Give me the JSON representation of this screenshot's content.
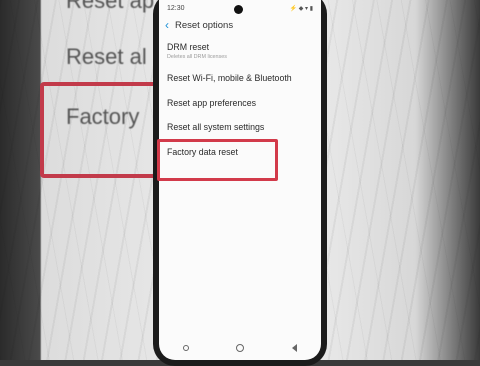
{
  "status_bar": {
    "time": "12:30",
    "icons": "⚡ ◆ ▾ ▮"
  },
  "header": {
    "title": "Reset options"
  },
  "settings_items": [
    {
      "label": "DRM reset",
      "subtitle": "Deletes all DRM licenses"
    },
    {
      "label": "Reset Wi-Fi, mobile & Bluetooth"
    },
    {
      "label": "Reset app preferences"
    },
    {
      "label": "Reset all system settings"
    },
    {
      "label": "Factory data reset"
    }
  ],
  "background_zoom": {
    "lines": [
      "Reset ap",
      "Reset al",
      "Factory"
    ]
  },
  "colors": {
    "accent": "#1a8fd6",
    "highlight": "#d23a4a"
  }
}
